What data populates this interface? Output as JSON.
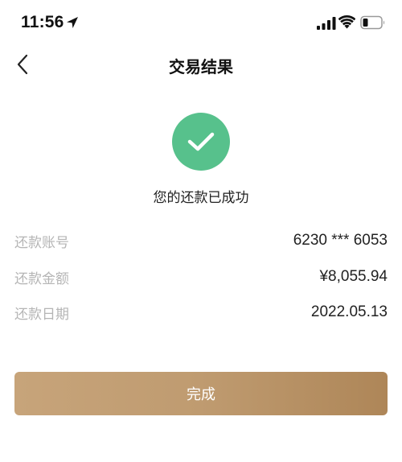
{
  "status_bar": {
    "time": "11:56",
    "icons": [
      "location-arrow-icon",
      "cellular-signal-icon",
      "wifi-icon",
      "battery-icon"
    ]
  },
  "nav": {
    "title": "交易结果",
    "back_icon": "chevron-left-icon"
  },
  "result": {
    "icon": "check-icon",
    "message": "您的还款已成功",
    "success_color": "#57c18c"
  },
  "details": [
    {
      "label": "还款账号",
      "value": "6230 *** 6053"
    },
    {
      "label": "还款金额",
      "value": "¥8,055.94"
    },
    {
      "label": "还款日期",
      "value": "2022.05.13"
    }
  ],
  "done_button": {
    "label": "完成",
    "gradient_colors": [
      "#c7a47a",
      "#ae8658"
    ]
  }
}
